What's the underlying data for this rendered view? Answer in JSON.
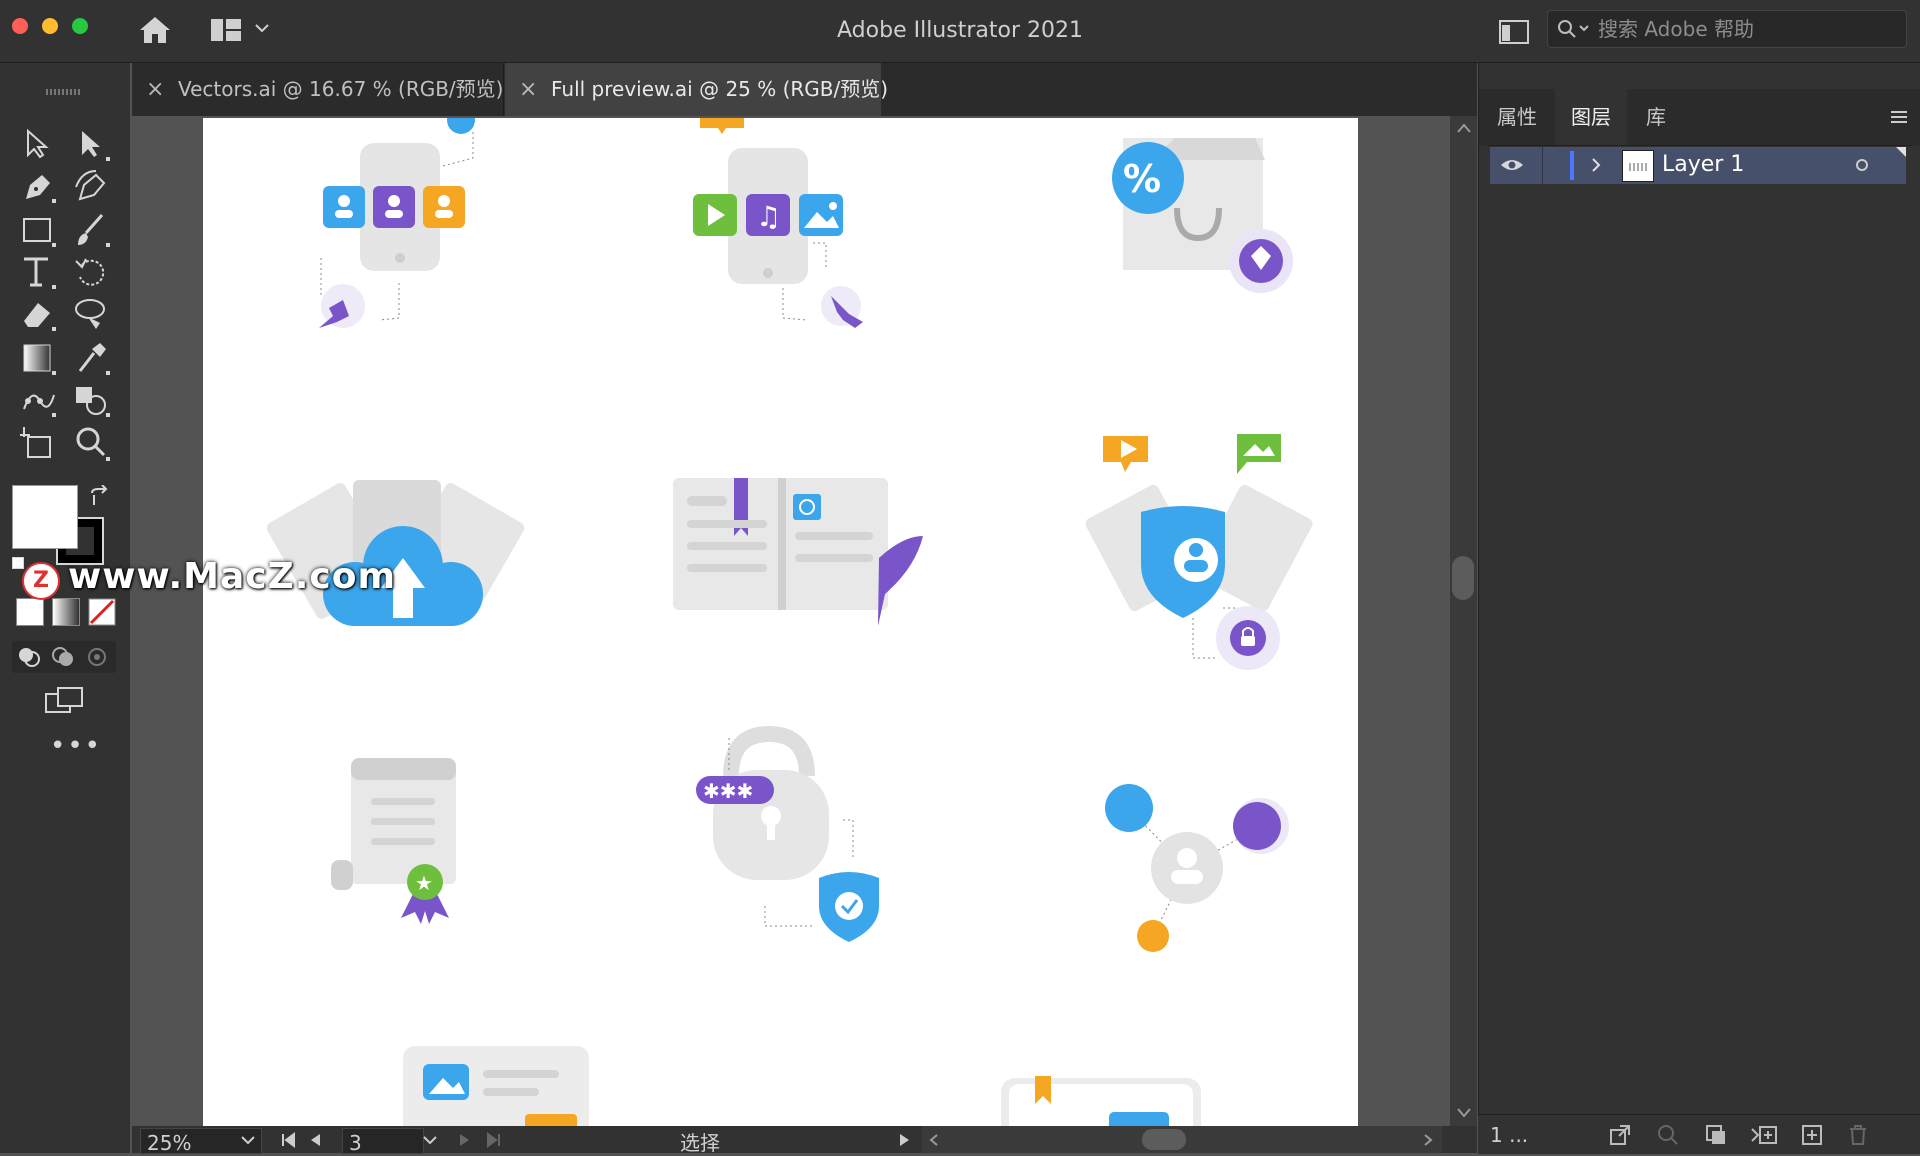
{
  "window": {
    "title": "Adobe Illustrator 2021"
  },
  "search": {
    "placeholder": "搜索 Adobe 帮助"
  },
  "tabs": [
    {
      "label": "Vectors.ai @ 16.67 % (RGB/预览)",
      "active": false
    },
    {
      "label": "Full preview.ai @ 25 % (RGB/预览)",
      "active": true
    }
  ],
  "panel": {
    "tabs": [
      {
        "label": "属性",
        "active": false
      },
      {
        "label": "图层",
        "active": true
      },
      {
        "label": "库",
        "active": false
      }
    ],
    "layers": [
      {
        "name": "Layer 1"
      }
    ],
    "footer_count": "1 ..."
  },
  "statusbar": {
    "zoom": "25%",
    "artboard_number": "3",
    "tool_label": "选择"
  },
  "watermark": {
    "text": "www.MacZ.com",
    "badge": "Z"
  },
  "colors": {
    "blue": "#3ba6ec",
    "purple": "#7a55c9",
    "orange": "#f5a623",
    "green": "#6fbf3e",
    "gray": "#e3e3e3",
    "accent_selection": "#46506a"
  }
}
